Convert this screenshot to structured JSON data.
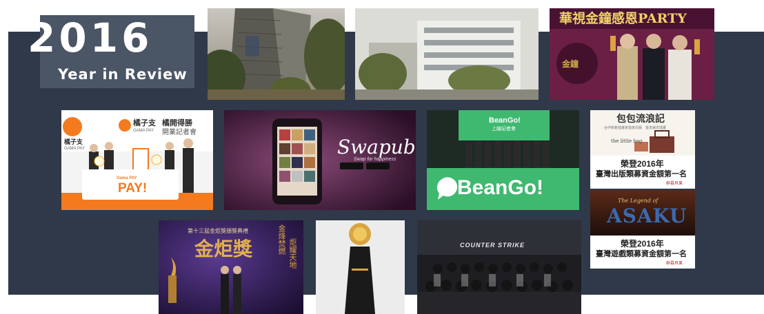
{
  "header": {
    "year": "2016",
    "subtitle": "Year in Review"
  },
  "tiles": {
    "gala": {
      "banner": "華視金鐘感恩PARTY"
    },
    "gamapay": {
      "brand_left": "橘子支",
      "brand_left_en": "GAMA PAY",
      "brand_center": "橘子支",
      "brand_center_en": "GAMA PAY",
      "event": "橘開得勝",
      "event_sub": "開業記者會",
      "podium": "PAY!",
      "podium_small": "Gama PAY"
    },
    "swapub": {
      "logo": "Swapub",
      "slogan": "Swap for happiness"
    },
    "beango": {
      "screen_logo": "BeanGo!",
      "screen_sub": "上線記者會",
      "big_logo": "BeanGo!"
    },
    "book": {
      "title": "包包流浪記",
      "subtitle": "台中新銳插畫家首度出版　首本繪本插畫",
      "cover": "the little bag",
      "award_line1": "榮登2016年",
      "award_line2": "臺灣出版類募資金額第一名",
      "credit": "群募貝果"
    },
    "asaku": {
      "top_text": "The Legend of",
      "logo": "ASAKU",
      "award_line1": "榮登2016年",
      "award_line2": "臺灣遊戲類募資金額第一名",
      "credit": "群募貝果"
    },
    "torch": {
      "header": "第十三屆金炬獎頒獎典禮",
      "big": "金炬獎",
      "side1": "金烽焚燃",
      "side2": "炬耀天地"
    },
    "event": {
      "logo": "COUNTER STRIKE"
    }
  },
  "colors": {
    "band": "#2f3949",
    "title_box": "#4a5565",
    "beango_green": "#3fb970",
    "gama_orange": "#f47a20",
    "swapub_purple": "#5a2a52",
    "gold": "#d9a441"
  }
}
